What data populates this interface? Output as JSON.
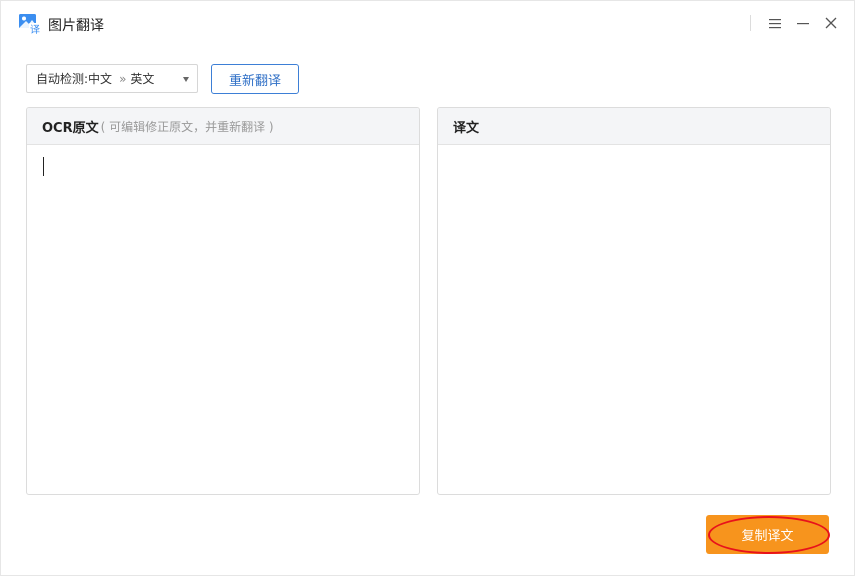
{
  "window": {
    "title": "图片翻译",
    "icon": "image-translate-icon"
  },
  "titlebar_controls": {
    "menu_icon": "menu-icon",
    "minimize_icon": "minimize-icon",
    "close_icon": "close-icon"
  },
  "toolbar": {
    "lang_prefix": "自动检测:",
    "source_lang": "中文",
    "arrow": "»",
    "target_lang": "英文",
    "retranslate_label": "重新翻译"
  },
  "source_panel": {
    "title": "OCR原文",
    "hint": "( 可编辑修正原文，并重新翻译 )",
    "text": ""
  },
  "target_panel": {
    "title": "译文",
    "text": ""
  },
  "actions": {
    "copy_label": "复制译文"
  },
  "colors": {
    "accent_blue": "#2f6fc6",
    "copy_button": "#f7941d",
    "highlight_ring": "#e8121b"
  }
}
